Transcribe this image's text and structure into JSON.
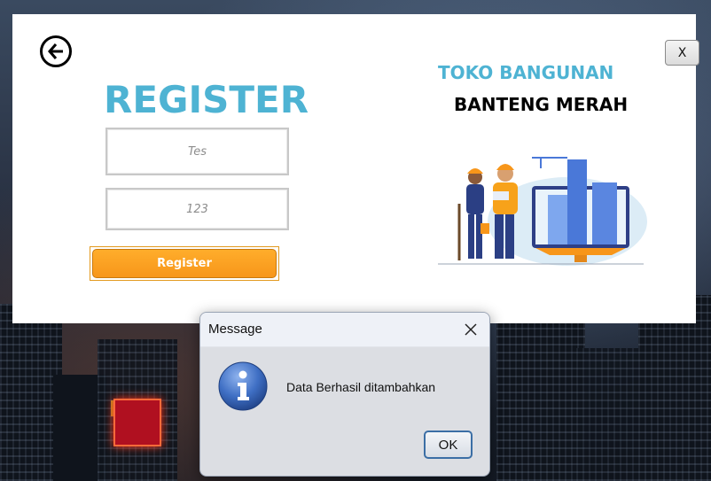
{
  "register_form": {
    "title": "REGISTER",
    "username_value": "Tes",
    "password_value": "123",
    "register_label": "Register",
    "close_label": "X"
  },
  "shop": {
    "title": "TOKO BANGUNAN",
    "subtitle": "BANTENG MERAH"
  },
  "dialog": {
    "title": "Message",
    "message": "Data Berhasil ditambahkan",
    "ok_label": "OK"
  },
  "icons": {
    "back": "arrow-left-circle-icon",
    "dialog_close": "close-icon",
    "info": "info-icon"
  },
  "colors": {
    "accent_blue": "#4eb3d3",
    "button_orange": "#f7961a",
    "dialog_info": "#2f5fb3"
  }
}
